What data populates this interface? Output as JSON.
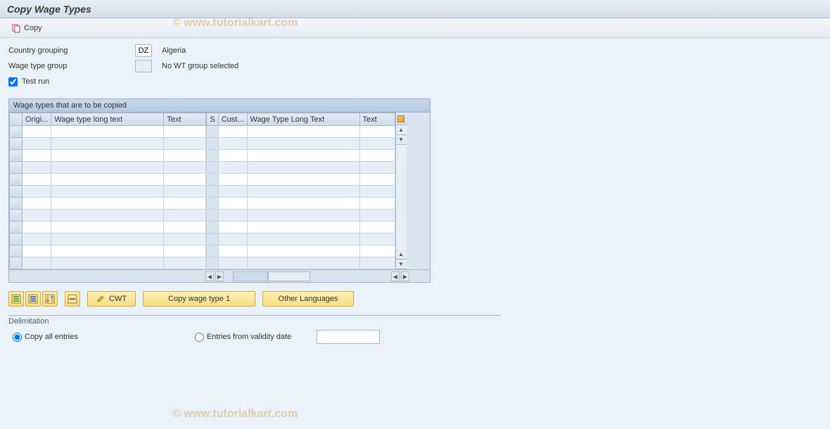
{
  "title": "Copy Wage Types",
  "toolbar": {
    "copy_label": "Copy"
  },
  "watermark": "© www.tutorialkart.com",
  "form": {
    "country_grouping_label": "Country grouping",
    "country_grouping_value": "DZ",
    "country_grouping_desc": "Algeria",
    "wage_type_group_label": "Wage type group",
    "wage_type_group_value": "",
    "wage_type_group_desc": "No WT group selected",
    "test_run_label": "Test run",
    "test_run_checked": true
  },
  "table": {
    "title": "Wage types that are to be copied",
    "columns": {
      "origi": "Origi...",
      "wage_long": "Wage type long text",
      "text1": "Text",
      "s": "S",
      "cust": "Cust...",
      "wage_long2": "Wage Type Long Text",
      "text2": "Text"
    },
    "row_count": 12
  },
  "buttons": {
    "cwt_label": "CWT",
    "copy_wt1_label": "Copy wage type 1",
    "other_lang_label": "Other Languages"
  },
  "delimitation": {
    "title": "Delimitation",
    "opt1_label": "Copy all entries",
    "opt2_label": "Entries from validity date",
    "selected": "opt1",
    "date_value": ""
  }
}
